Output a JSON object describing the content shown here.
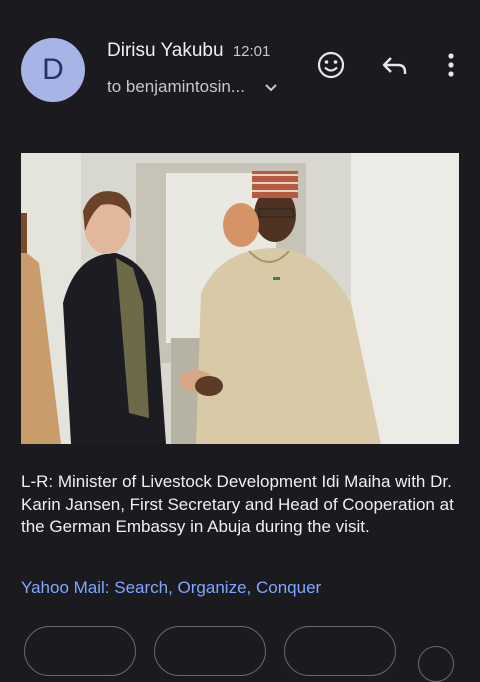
{
  "header": {
    "avatar_letter": "D",
    "sender_name": "Dirisu Yakubu",
    "time": "12:01",
    "recipient": "to benjamintosin..."
  },
  "icons": {
    "emoji": "emoji-react-icon",
    "reply": "reply-icon",
    "more": "more-vert-icon",
    "chevron": "chevron-down-icon"
  },
  "body": {
    "caption": "L-R: Minister of Livestock Development Idi Maiha with Dr. Karin Jansen, First Secretary and Head of Cooperation at the German Embassy in Abuja during the visit.",
    "signature_link": "Yahoo Mail: Search, Organize, Conquer"
  },
  "colors": {
    "background": "#1b1a1f",
    "avatar": "#a8b4e6",
    "link": "#7fa8ff"
  }
}
